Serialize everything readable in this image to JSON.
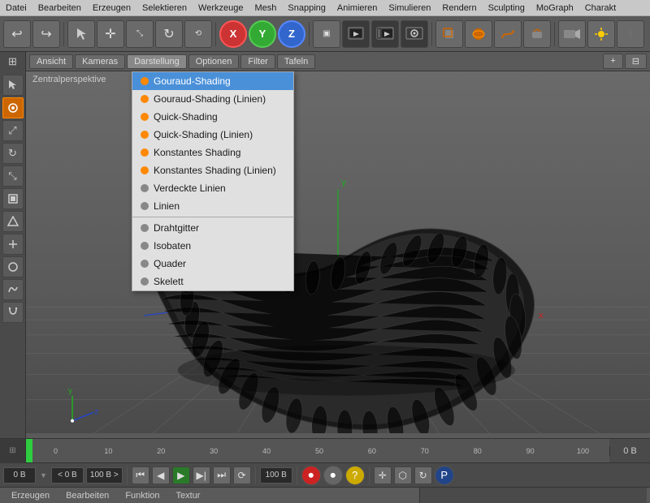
{
  "menubar": {
    "items": [
      "Datei",
      "Bearbeiten",
      "Erzeugen",
      "Selektieren",
      "Werkzeuge",
      "Mesh",
      "Snapping",
      "Animieren",
      "Simulieren",
      "Rendern",
      "Sculpting",
      "MoGraph",
      "Charakt"
    ]
  },
  "toolbar": {
    "undo_label": "↩",
    "redo_label": "↪"
  },
  "secondary_toolbar": {
    "tabs": [
      "Ansicht",
      "Kameras",
      "Darstellung",
      "Optionen",
      "Filter",
      "Tafeln"
    ],
    "active_tab": "Darstellung"
  },
  "viewport": {
    "label": "Zentralperspektive"
  },
  "dropdown": {
    "items": [
      {
        "id": "gouraud",
        "label": "Gouraud-Shading",
        "dot": "orange",
        "selected": true
      },
      {
        "id": "gouraud-lines",
        "label": "Gouraud-Shading (Linien)",
        "dot": "orange"
      },
      {
        "id": "quick",
        "label": "Quick-Shading",
        "dot": "orange"
      },
      {
        "id": "quick-lines",
        "label": "Quick-Shading (Linien)",
        "dot": "orange"
      },
      {
        "id": "konstant",
        "label": "Konstantes Shading",
        "dot": "orange"
      },
      {
        "id": "konstant-lines",
        "label": "Konstantes Shading (Linien)",
        "dot": "orange"
      },
      {
        "id": "hidden",
        "label": "Verdeckte Linien",
        "dot": "gray"
      },
      {
        "id": "linien",
        "label": "Linien",
        "dot": "gray"
      },
      {
        "id": "sep",
        "label": ""
      },
      {
        "id": "draht",
        "label": "Drahtgitter",
        "dot": "gray"
      },
      {
        "id": "isobaten",
        "label": "Isobaten",
        "dot": "gray"
      },
      {
        "id": "quader",
        "label": "Quader",
        "dot": "gray"
      },
      {
        "id": "skelett",
        "label": "Skelett",
        "dot": "gray"
      }
    ]
  },
  "timeline": {
    "numbers": [
      "0",
      "10",
      "20",
      "30",
      "40",
      "50",
      "60",
      "70",
      "80",
      "90",
      "100"
    ],
    "right_label": "0 B"
  },
  "transport": {
    "field1": "0 B",
    "field2": "< 0 B",
    "field3": "100 B >",
    "field4": "100 B"
  },
  "bottom_tabs": {
    "items": [
      "Erzeugen",
      "Bearbeiten",
      "Funktion",
      "Textur"
    ]
  },
  "left_panel": {
    "icons": [
      "▶",
      "◼",
      "⟲",
      "⬡",
      "⬛",
      "⬡",
      "◈",
      "⊕",
      "✦",
      "⬦",
      "◯"
    ]
  },
  "axes": {
    "x": "X",
    "y": "Y",
    "z": "Z"
  }
}
